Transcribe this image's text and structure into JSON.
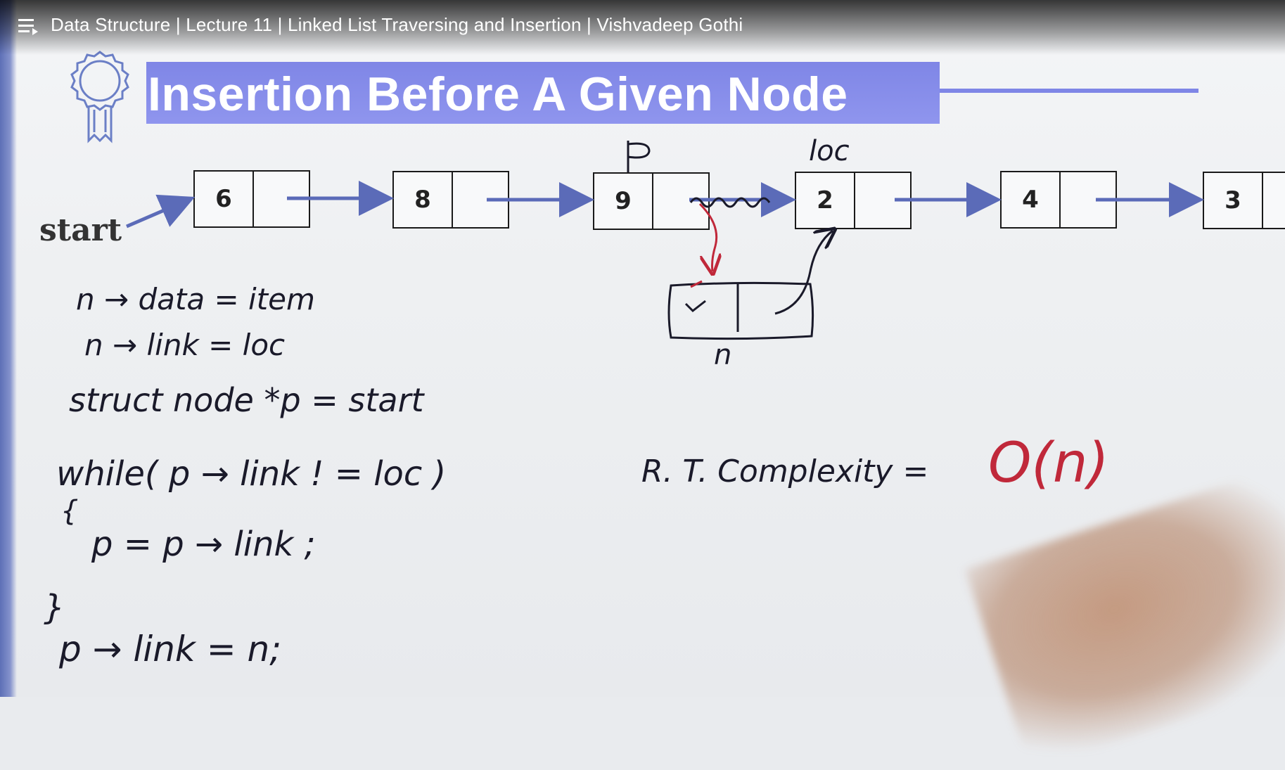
{
  "player": {
    "title": "Data Structure | Lecture 11 | Linked List Traversing and Insertion | Vishvadeep Gothi",
    "icons": {
      "menu": "playlist-menu-icon",
      "badge": "award-badge-icon"
    }
  },
  "slide": {
    "heading": "Insertion Before A Given Node",
    "start_label": "start",
    "nodes": [
      "6",
      "8",
      "9",
      "2",
      "4",
      "3"
    ],
    "colors": {
      "banner": "#7f86e6",
      "arrow": "#5b6bb8",
      "red_ink": "#c0283a",
      "ink": "#1a1a2a"
    }
  },
  "annotations": {
    "p_label": "p",
    "loc_label": "loc",
    "new_node_label": "n",
    "code_lines": [
      "n → data = item",
      "n → link = loc",
      "struct node *p = start",
      "while( p → link ! = loc )",
      "{",
      "p = p → link ;",
      "}",
      "p → link = n;"
    ],
    "complexity_label": "R. T. Complexity =",
    "complexity_value": "O(n)"
  }
}
